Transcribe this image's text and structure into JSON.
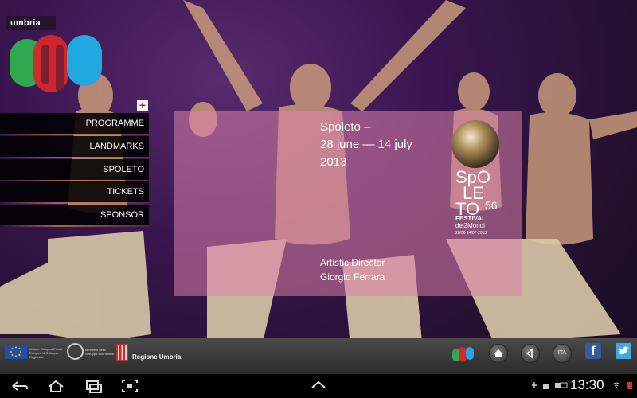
{
  "brand": {
    "label": "umbria"
  },
  "menu": {
    "expand_label": "+",
    "items": [
      {
        "label": "PROGRAMME"
      },
      {
        "label": "LANDMARKS"
      },
      {
        "label": "SPOLETO"
      },
      {
        "label": "TICKETS"
      },
      {
        "label": "SPONSOR"
      }
    ]
  },
  "event": {
    "title_line1": "Spoleto –",
    "title_line2": "28 june — 14 july",
    "title_line3": "2013",
    "director_label": "Artistic Director",
    "director_name": "Giorgio Ferrara"
  },
  "festival_logo": {
    "row1": "SpO",
    "row2": "LE",
    "row3": "TO",
    "number": "56",
    "festival_word": "FESTIVAL",
    "subtitle": "dei2Mondi",
    "dates": "28/06 14/07·2013"
  },
  "footer": {
    "eu_text": "Unione Europea Fondo Europeo di Sviluppo Regionale",
    "ministry_text": "Ministero dello Sviluppo Economico",
    "region_label": "Regione Umbria",
    "lang_label": "ITA",
    "facebook_glyph": "f"
  },
  "statusbar": {
    "time": "13:30"
  },
  "colors": {
    "menu_bg": "#000000",
    "panel": "#da82aa",
    "logo_red": "#d9262b",
    "logo_green": "#2fa84f",
    "logo_blue": "#21a8e1"
  }
}
